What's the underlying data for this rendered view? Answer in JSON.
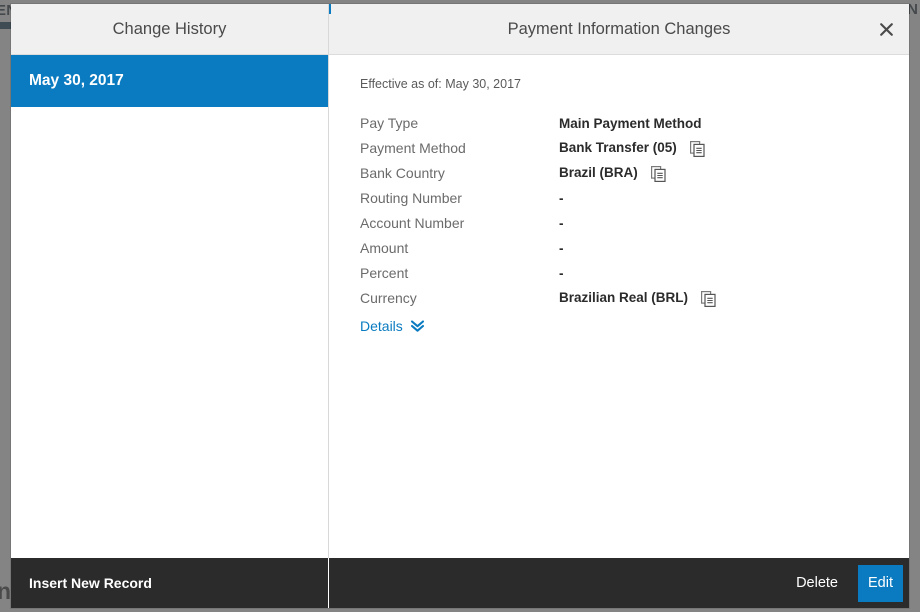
{
  "background_page": {
    "top_left_text": "EN",
    "top_right_text": "N",
    "bottom_left_text": "n"
  },
  "colors": {
    "accent_blue": "#0a7bc0",
    "header_bg": "#f0f0f0",
    "footer_bg": "#2b2b2b",
    "overlay": "#555555",
    "label_grey": "#6b6b6b",
    "value_dark": "#2b2b2b"
  },
  "header": {
    "left_title": "Change History",
    "right_title": "Payment Information Changes",
    "close_icon": "close-icon"
  },
  "history": {
    "items": [
      {
        "label": "May 30, 2017",
        "selected": true
      }
    ]
  },
  "detail": {
    "effective_line": "Effective as of: May 30, 2017",
    "rows": [
      {
        "label": "Pay Type",
        "value": "Main Payment Method",
        "copy": false
      },
      {
        "label": "Payment Method",
        "value": "Bank Transfer (05)",
        "copy": true
      },
      {
        "label": "Bank Country",
        "value": "Brazil (BRA)",
        "copy": true
      },
      {
        "label": "Routing Number",
        "value": "-",
        "copy": false
      },
      {
        "label": "Account Number",
        "value": "-",
        "copy": false
      },
      {
        "label": "Amount",
        "value": "-",
        "copy": false
      },
      {
        "label": "Percent",
        "value": "-",
        "copy": false
      },
      {
        "label": "Currency",
        "value": "Brazilian Real (BRL)",
        "copy": true
      }
    ],
    "details_link": "Details",
    "details_icon": "double-chevron-down-icon",
    "copy_icon": "copy-document-icon"
  },
  "footer": {
    "insert_label": "Insert New Record",
    "delete_label": "Delete",
    "edit_label": "Edit"
  }
}
